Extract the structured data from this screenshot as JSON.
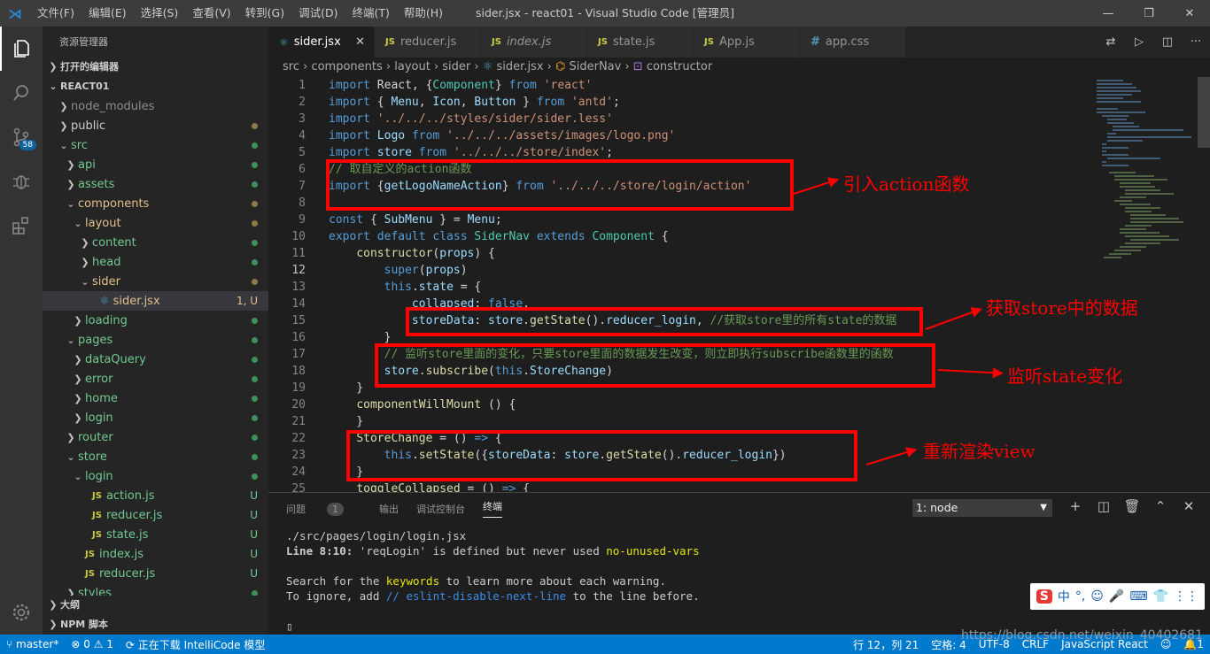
{
  "title": {
    "menus": [
      "文件(F)",
      "编辑(E)",
      "选择(S)",
      "查看(V)",
      "转到(G)",
      "调试(D)",
      "终端(T)",
      "帮助(H)"
    ],
    "window_title": "sider.jsx - react01 - Visual Studio Code [管理员]"
  },
  "activity": {
    "scm_badge": "58"
  },
  "sidebar": {
    "title": "资源管理器",
    "open_editors": "打开的编辑器",
    "project": "REACT01",
    "tree": [
      {
        "label": "node_modules",
        "indent": 0,
        "kind": "folder",
        "open": false,
        "status": "",
        "color": "#8c8c8c"
      },
      {
        "label": "public",
        "indent": 0,
        "kind": "folder",
        "open": false,
        "status": "dot",
        "color": "#ccc",
        "dotcolor": "#8c7a44"
      },
      {
        "label": "src",
        "indent": 0,
        "kind": "folder",
        "open": true,
        "status": "dot",
        "color": "#73c991",
        "dotcolor": "#3f8f5a"
      },
      {
        "label": "api",
        "indent": 1,
        "kind": "folder",
        "open": false,
        "status": "dot",
        "color": "#73c991",
        "dotcolor": "#3f8f5a"
      },
      {
        "label": "assets",
        "indent": 1,
        "kind": "folder",
        "open": false,
        "status": "dot",
        "color": "#73c991",
        "dotcolor": "#3f8f5a"
      },
      {
        "label": "components",
        "indent": 1,
        "kind": "folder",
        "open": true,
        "status": "dot",
        "color": "#e2c08d",
        "dotcolor": "#8c7a44"
      },
      {
        "label": "layout",
        "indent": 2,
        "kind": "folder",
        "open": true,
        "status": "dot",
        "color": "#e2c08d",
        "dotcolor": "#8c7a44"
      },
      {
        "label": "content",
        "indent": 3,
        "kind": "folder",
        "open": false,
        "status": "dot",
        "color": "#73c991",
        "dotcolor": "#3f8f5a"
      },
      {
        "label": "head",
        "indent": 3,
        "kind": "folder",
        "open": false,
        "status": "dot",
        "color": "#73c991",
        "dotcolor": "#3f8f5a"
      },
      {
        "label": "sider",
        "indent": 3,
        "kind": "folder",
        "open": true,
        "status": "dot",
        "color": "#e2c08d",
        "dotcolor": "#8c7a44"
      },
      {
        "label": "sider.jsx",
        "indent": 4,
        "kind": "react",
        "open": false,
        "status": "1, U",
        "color": "#e2c08d",
        "selected": true
      },
      {
        "label": "loading",
        "indent": 2,
        "kind": "folder",
        "open": false,
        "status": "dot",
        "color": "#73c991",
        "dotcolor": "#3f8f5a"
      },
      {
        "label": "pages",
        "indent": 1,
        "kind": "folder",
        "open": true,
        "status": "dot",
        "color": "#73c991",
        "dotcolor": "#3f8f5a"
      },
      {
        "label": "dataQuery",
        "indent": 2,
        "kind": "folder",
        "open": false,
        "status": "dot",
        "color": "#73c991",
        "dotcolor": "#3f8f5a"
      },
      {
        "label": "error",
        "indent": 2,
        "kind": "folder",
        "open": false,
        "status": "dot",
        "color": "#73c991",
        "dotcolor": "#3f8f5a"
      },
      {
        "label": "home",
        "indent": 2,
        "kind": "folder",
        "open": false,
        "status": "dot",
        "color": "#73c991",
        "dotcolor": "#3f8f5a"
      },
      {
        "label": "login",
        "indent": 2,
        "kind": "folder",
        "open": false,
        "status": "dot",
        "color": "#73c991",
        "dotcolor": "#3f8f5a"
      },
      {
        "label": "router",
        "indent": 1,
        "kind": "folder",
        "open": false,
        "status": "dot",
        "color": "#73c991",
        "dotcolor": "#3f8f5a"
      },
      {
        "label": "store",
        "indent": 1,
        "kind": "folder",
        "open": true,
        "status": "dot",
        "color": "#73c991",
        "dotcolor": "#3f8f5a"
      },
      {
        "label": "login",
        "indent": 2,
        "kind": "folder",
        "open": true,
        "status": "dot",
        "color": "#73c991",
        "dotcolor": "#3f8f5a"
      },
      {
        "label": "action.js",
        "indent": 3,
        "kind": "js",
        "open": false,
        "status": "U",
        "color": "#73c991"
      },
      {
        "label": "reducer.js",
        "indent": 3,
        "kind": "js",
        "open": false,
        "status": "U",
        "color": "#73c991"
      },
      {
        "label": "state.js",
        "indent": 3,
        "kind": "js",
        "open": false,
        "status": "U",
        "color": "#73c991"
      },
      {
        "label": "index.js",
        "indent": 2,
        "kind": "js",
        "open": false,
        "status": "U",
        "color": "#73c991"
      },
      {
        "label": "reducer.js",
        "indent": 2,
        "kind": "js",
        "open": false,
        "status": "U",
        "color": "#73c991"
      },
      {
        "label": "styles",
        "indent": 1,
        "kind": "folder",
        "open": false,
        "status": "dot",
        "color": "#73c991",
        "dotcolor": "#3f8f5a"
      }
    ],
    "outline": "大纲",
    "npm": "NPM 脚本"
  },
  "tabs": [
    {
      "label": "sider.jsx",
      "icon": "react",
      "active": true,
      "italic": false
    },
    {
      "label": "reducer.js",
      "icon": "js",
      "active": false,
      "italic": false
    },
    {
      "label": "index.js",
      "icon": "js",
      "active": false,
      "italic": true
    },
    {
      "label": "state.js",
      "icon": "js",
      "active": false,
      "italic": false
    },
    {
      "label": "App.js",
      "icon": "js",
      "active": false,
      "italic": false
    },
    {
      "label": "app.css",
      "icon": "css",
      "active": false,
      "italic": false
    }
  ],
  "breadcrumb": [
    "src",
    "components",
    "layout",
    "sider",
    "sider.jsx",
    "SiderNav",
    "constructor"
  ],
  "code": {
    "current_line": 12,
    "lines": [
      [
        [
          "k",
          "import "
        ],
        [
          "p",
          "React, {"
        ],
        [
          "t",
          "Component"
        ],
        [
          "p",
          "} "
        ],
        [
          "k",
          "from "
        ],
        [
          "s",
          "'react'"
        ]
      ],
      [
        [
          "k",
          "import "
        ],
        [
          "p",
          "{ "
        ],
        [
          "v",
          "Menu"
        ],
        [
          "p",
          ", "
        ],
        [
          "v",
          "Icon"
        ],
        [
          "p",
          ", "
        ],
        [
          "v",
          "Button"
        ],
        [
          "p",
          " } "
        ],
        [
          "k",
          "from "
        ],
        [
          "s",
          "'antd'"
        ],
        [
          "p",
          ";"
        ]
      ],
      [
        [
          "k",
          "import "
        ],
        [
          "s",
          "'../../../styles/sider/sider.less'"
        ]
      ],
      [
        [
          "k",
          "import "
        ],
        [
          "v",
          "Logo "
        ],
        [
          "k",
          "from "
        ],
        [
          "s",
          "'../../../assets/images/logo.png'"
        ]
      ],
      [
        [
          "k",
          "import "
        ],
        [
          "v",
          "store "
        ],
        [
          "k",
          "from "
        ],
        [
          "s",
          "'../../../store/index'"
        ],
        [
          "p",
          ";"
        ]
      ],
      [
        [
          "c",
          "// 取自定义的action函数"
        ]
      ],
      [
        [
          "k",
          "import "
        ],
        [
          "p",
          "{"
        ],
        [
          "v",
          "getLogoNameAction"
        ],
        [
          "p",
          "} "
        ],
        [
          "k",
          "from "
        ],
        [
          "s",
          "'../../../store/login/action'"
        ]
      ],
      [],
      [
        [
          "k",
          "const "
        ],
        [
          "p",
          "{ "
        ],
        [
          "v",
          "SubMenu "
        ],
        [
          "p",
          "} = "
        ],
        [
          "v",
          "Menu"
        ],
        [
          "p",
          ";"
        ]
      ],
      [
        [
          "k",
          "export default class "
        ],
        [
          "t",
          "SiderNav "
        ],
        [
          "k",
          "extends "
        ],
        [
          "t",
          "Component "
        ],
        [
          "p",
          "{"
        ]
      ],
      [
        [
          "p",
          "    "
        ],
        [
          "f",
          "constructor"
        ],
        [
          "p",
          "("
        ],
        [
          "v",
          "props"
        ],
        [
          "p",
          ") {"
        ]
      ],
      [
        [
          "p",
          "        "
        ],
        [
          "k",
          "super"
        ],
        [
          "p",
          "("
        ],
        [
          "v",
          "props"
        ],
        [
          "p",
          ")"
        ]
      ],
      [
        [
          "p",
          "        "
        ],
        [
          "k",
          "this"
        ],
        [
          "p",
          "."
        ],
        [
          "v",
          "state "
        ],
        [
          "p",
          "= {"
        ]
      ],
      [
        [
          "p",
          "            "
        ],
        [
          "v",
          "collapsed"
        ],
        [
          "p",
          ": "
        ],
        [
          "k",
          "false"
        ],
        [
          "p",
          ","
        ]
      ],
      [
        [
          "p",
          "            "
        ],
        [
          "v",
          "storeData"
        ],
        [
          "p",
          ": "
        ],
        [
          "v",
          "store"
        ],
        [
          "p",
          "."
        ],
        [
          "f",
          "getState"
        ],
        [
          "p",
          "()."
        ],
        [
          "v",
          "reducer_login"
        ],
        [
          "p",
          ", "
        ],
        [
          "c",
          "//获取store里的所有state的数据"
        ]
      ],
      [
        [
          "p",
          "        }"
        ]
      ],
      [
        [
          "p",
          "        "
        ],
        [
          "c",
          "// 监听store里面的变化，只要store里面的数据发生改变，则立即执行subscribe函数里的函数"
        ]
      ],
      [
        [
          "p",
          "        "
        ],
        [
          "v",
          "store"
        ],
        [
          "p",
          "."
        ],
        [
          "f",
          "subscribe"
        ],
        [
          "p",
          "("
        ],
        [
          "k",
          "this"
        ],
        [
          "p",
          "."
        ],
        [
          "v",
          "StoreChange"
        ],
        [
          "p",
          ")"
        ]
      ],
      [
        [
          "p",
          "    }"
        ]
      ],
      [
        [
          "p",
          "    "
        ],
        [
          "f",
          "componentWillMount "
        ],
        [
          "p",
          "() {"
        ]
      ],
      [
        [
          "p",
          "    }"
        ]
      ],
      [
        [
          "p",
          "    "
        ],
        [
          "f",
          "StoreChange "
        ],
        [
          "p",
          "= () "
        ],
        [
          "k",
          "=> "
        ],
        [
          "p",
          "{"
        ]
      ],
      [
        [
          "p",
          "        "
        ],
        [
          "k",
          "this"
        ],
        [
          "p",
          "."
        ],
        [
          "f",
          "setState"
        ],
        [
          "p",
          "({"
        ],
        [
          "v",
          "storeData"
        ],
        [
          "p",
          ": "
        ],
        [
          "v",
          "store"
        ],
        [
          "p",
          "."
        ],
        [
          "f",
          "getState"
        ],
        [
          "p",
          "()."
        ],
        [
          "v",
          "reducer_login"
        ],
        [
          "p",
          "})"
        ]
      ],
      [
        [
          "p",
          "    }"
        ]
      ],
      [
        [
          "p",
          "    "
        ],
        [
          "f",
          "toggleCollapsed "
        ],
        [
          "p",
          "= () "
        ],
        [
          "k",
          "=> "
        ],
        [
          "p",
          "{"
        ]
      ]
    ]
  },
  "annotations": {
    "a1": "引入action函数",
    "a2": "获取store中的数据",
    "a3": "监听state变化",
    "a4": "重新渲染view"
  },
  "panel": {
    "tabs": [
      "问题",
      "输出",
      "调试控制台",
      "终端"
    ],
    "problem_count": "1",
    "terminal_select": "1: node",
    "term": {
      "l1": "./src/pages/login/login.jsx",
      "l2a": "  Line 8:10:",
      "l2b": "  'reqLogin' is defined but never used  ",
      "l2c": "no-unused-vars",
      "l3a": "Search for the ",
      "l3b": "keywords",
      "l3c": " to learn more about each warning.",
      "l4a": "To ignore, add ",
      "l4b": "// eslint-disable-next-line",
      "l4c": " to the line before.",
      "cursor": "▯"
    }
  },
  "ime": {
    "logo": "S",
    "items": [
      "中",
      "°,",
      "☺",
      "🎤",
      "⌨",
      "👕",
      "⋮⋮"
    ]
  },
  "status": {
    "branch": "master*",
    "errors": "0",
    "warnings": "1",
    "intellicode": "正在下载 IntelliCode 模型",
    "position": "行 12，列 21",
    "spaces": "空格: 4",
    "encoding": "UTF-8",
    "eol": "CRLF",
    "language": "JavaScript React",
    "bell": "1"
  },
  "watermark": "https://blog.csdn.net/weixin_40402681"
}
